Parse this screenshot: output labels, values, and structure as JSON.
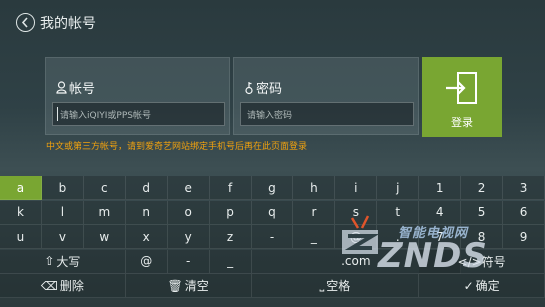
{
  "header": {
    "title": "我的帐号"
  },
  "account": {
    "label": "帐号",
    "placeholder": "请输入iQIYI或PPS帐号"
  },
  "password": {
    "label": "密码",
    "placeholder": "请输入密码"
  },
  "login_button": {
    "label": "登录"
  },
  "hint": "中文或第三方帐号，请到爱奇艺网站绑定手机号后再在此页面登录",
  "keyboard": {
    "selected": "a",
    "rows": [
      [
        "a",
        "b",
        "c",
        "d",
        "e",
        "f",
        "g",
        "h",
        "i",
        "j",
        "1",
        "2",
        "3"
      ],
      [
        "k",
        "l",
        "m",
        "n",
        "o",
        "p",
        "q",
        "r",
        "s",
        "t",
        "4",
        "5",
        "6"
      ],
      [
        "u",
        "v",
        "w",
        "x",
        "y",
        "z",
        "-",
        "_",
        "@",
        ".",
        "7",
        "8",
        "9"
      ]
    ],
    "row4": {
      "shift": "大写",
      "at": "@",
      "dash": "-",
      "underscore": "_",
      "dotcom": ".com",
      "symbols": "</>符号"
    },
    "row5": {
      "delete": "删除",
      "clear": "清空",
      "space": "空格",
      "confirm": "确定"
    }
  },
  "watermark": {
    "cn": "智能电视网",
    "en": "ZNDS"
  }
}
